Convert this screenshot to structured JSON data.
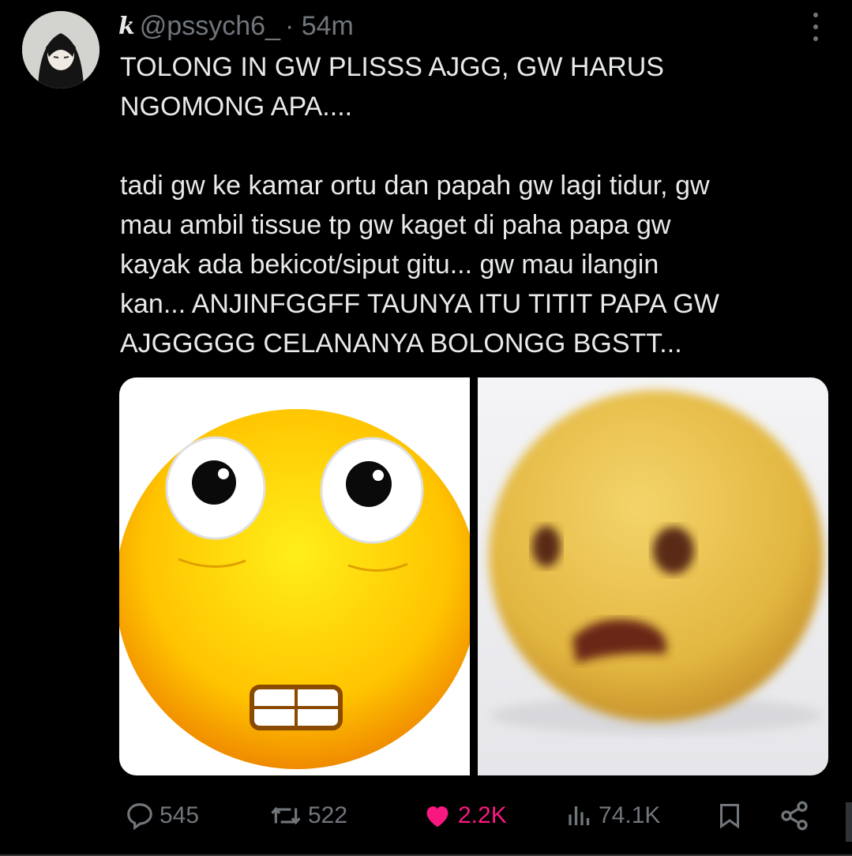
{
  "tweet": {
    "handle": "@pssych6_",
    "time": "· 54m",
    "text": "TOLONG IN GW PLISSS AJGG, GW HARUS\nNGOMONG APA....\n\ntadi gw ke kamar ortu dan papah gw lagi tidur, gw\nmau ambil tissue tp gw kaget di paha papa gw\nkayak ada bekicot/siput gitu... gw mau ilangin\nkan... ANJINFGGFF TAUNYA ITU TITIT PAPA GW\nAJGGGGG CELANANYA BOLONGG BGSTT...",
    "badge_icon": "k-badge-icon"
  },
  "media": [
    {
      "name": "emoji-blush-image",
      "icon": "yellow-emoji-wide-eyes"
    },
    {
      "name": "emoji-shocked-image",
      "icon": "blurry-emoji-shocked"
    }
  ],
  "actions": {
    "replies": "545",
    "reposts": "522",
    "likes": "2.2K",
    "views": "74.1K"
  },
  "colors": {
    "background": "#000000",
    "text": "#e7e9ea",
    "muted": "#71767b",
    "like": "#f91880"
  }
}
